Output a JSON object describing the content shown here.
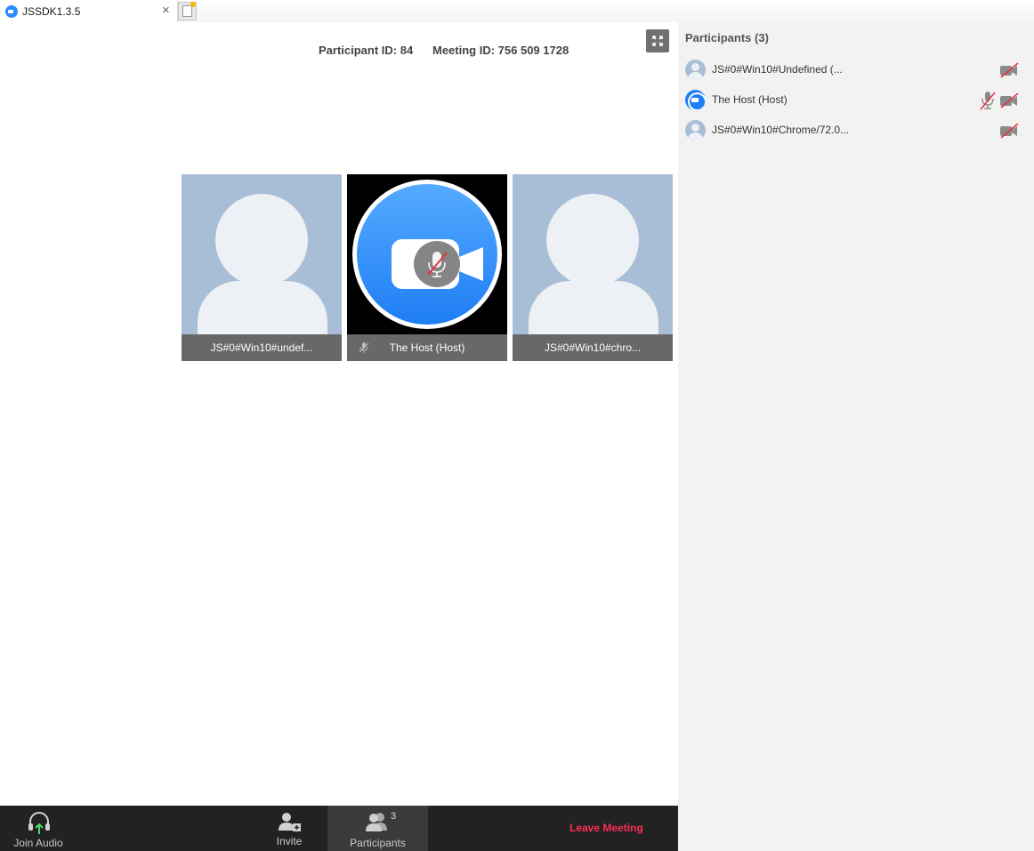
{
  "browser": {
    "tab_title": "JSSDK1.3.5",
    "close_symbol": "×"
  },
  "meeting": {
    "participant_id_text": "Participant ID: 84",
    "meeting_id_text": "Meeting ID: 756 509 1728"
  },
  "video_tiles": [
    {
      "name": "JS#0#Win10#undef...",
      "type": "avatar"
    },
    {
      "name": "The Host (Host)",
      "type": "host",
      "muted": true
    },
    {
      "name": "JS#0#Win10#chro...",
      "type": "avatar"
    }
  ],
  "panel": {
    "title": "Participants",
    "count": "(3)",
    "participants": [
      {
        "name": "JS#0#Win10#Undefined (...",
        "video_off": true
      },
      {
        "name": "The Host (Host)",
        "muted": true,
        "video_off": true
      },
      {
        "name": "JS#0#Win10#Chrome/72.0...",
        "video_off": true
      }
    ]
  },
  "footer": {
    "join_audio": "Join Audio",
    "invite": "Invite",
    "participants": "Participants",
    "participants_count": "3",
    "leave": "Leave Meeting"
  },
  "colors": {
    "accent_blue": "#2d8cff",
    "leave_red": "#ff2d55",
    "toolbar_bg": "#222222",
    "panel_bg": "#f2f2f2",
    "avatar_bg": "#a8bdd6"
  }
}
